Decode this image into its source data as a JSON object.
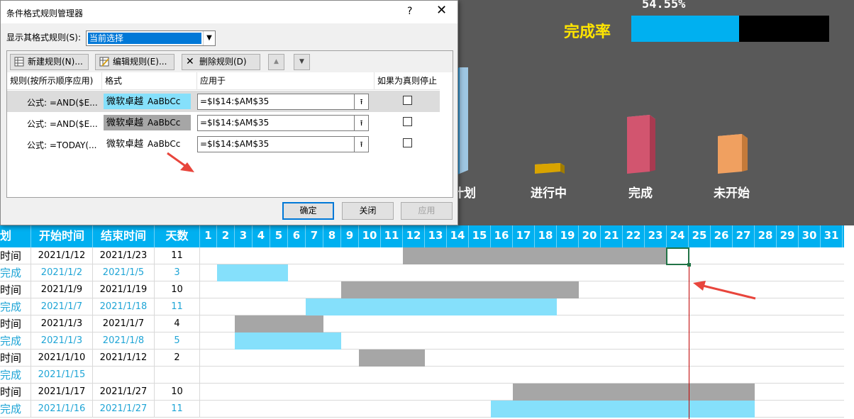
{
  "dashboard": {
    "completion_pct": "54.55%",
    "completion_label": "完成率",
    "completion_fraction": 0.5455,
    "categories": [
      "计划",
      "进行中",
      "完成",
      "未开始"
    ],
    "category_partial": "计划",
    "colors": {
      "bar_fill": "#00b0f0",
      "bar_bg": "#000000",
      "rate_label": "#ffe500",
      "bg": "#595959"
    }
  },
  "grid": {
    "headers": [
      "划",
      "开始时间",
      "结束时间",
      "天数"
    ],
    "days": [
      "1",
      "2",
      "3",
      "4",
      "5",
      "6",
      "7",
      "8",
      "9",
      "10",
      "11",
      "12",
      "13",
      "14",
      "15",
      "16",
      "17",
      "18",
      "19",
      "20",
      "21",
      "22",
      "23",
      "24",
      "25",
      "26",
      "27",
      "28",
      "29",
      "30",
      "31"
    ],
    "rows": [
      {
        "type": "plan",
        "c0": "时间",
        "start": "2021/1/12",
        "end": "2021/1/23",
        "days": "11",
        "bar_from": 12,
        "bar_to": 23
      },
      {
        "type": "done",
        "c0": "完成",
        "start": "2021/1/2",
        "end": "2021/1/5",
        "days": "3",
        "bar_from": 2,
        "bar_to": 5
      },
      {
        "type": "plan",
        "c0": "时间",
        "start": "2021/1/9",
        "end": "2021/1/19",
        "days": "10",
        "bar_from": 9,
        "bar_to": 19
      },
      {
        "type": "done",
        "c0": "完成",
        "start": "2021/1/7",
        "end": "2021/1/18",
        "days": "11",
        "bar_from": 7,
        "bar_to": 18
      },
      {
        "type": "plan",
        "c0": "时间",
        "start": "2021/1/3",
        "end": "2021/1/7",
        "days": "4",
        "bar_from": 3,
        "bar_to": 7
      },
      {
        "type": "done",
        "c0": "完成",
        "start": "2021/1/3",
        "end": "2021/1/8",
        "days": "5",
        "bar_from": 3,
        "bar_to": 8
      },
      {
        "type": "plan",
        "c0": "时间",
        "start": "2021/1/10",
        "end": "2021/1/12",
        "days": "2",
        "bar_from": 10,
        "bar_to": 12
      },
      {
        "type": "done",
        "c0": "完成",
        "start": "2021/1/15",
        "end": "",
        "days": "",
        "bar_from": null,
        "bar_to": null
      },
      {
        "type": "plan",
        "c0": "时间",
        "start": "2021/1/17",
        "end": "2021/1/27",
        "days": "10",
        "bar_from": 17,
        "bar_to": 27
      },
      {
        "type": "done",
        "c0": "完成",
        "start": "2021/1/16",
        "end": "2021/1/27",
        "days": "11",
        "bar_from": 16,
        "bar_to": 27
      }
    ],
    "today_day": 24
  },
  "dialog": {
    "title": "条件格式规则管理器",
    "help": "?",
    "close": "✕",
    "show_label": "显示其格式规则(S):",
    "show_value": "当前选择",
    "buttons": {
      "new": "新建规则(N)...",
      "edit": "编辑规则(E)...",
      "delete": "删除规则(D)",
      "ok": "确定",
      "close": "关闭",
      "apply": "应用"
    },
    "columns": [
      "规则(按所示顺序应用)",
      "格式",
      "应用于",
      "如果为真则停止"
    ],
    "rules": [
      {
        "rule": "公式: =AND($E...",
        "fmt_cn": "微软卓越",
        "fmt_en": "AaBbCc",
        "applies": "=$I$14:$AM$35",
        "fmt_bg": "#85e0fb"
      },
      {
        "rule": "公式: =AND($E...",
        "fmt_cn": "微软卓越",
        "fmt_en": "AaBbCc",
        "applies": "=$I$14:$AM$35",
        "fmt_bg": "#a6a6a6"
      },
      {
        "rule": "公式: =TODAY(...",
        "fmt_cn": "微软卓越",
        "fmt_en": "AaBbCc",
        "applies": "=$I$14:$AM$35",
        "fmt_bg": "#ffffff"
      }
    ]
  }
}
